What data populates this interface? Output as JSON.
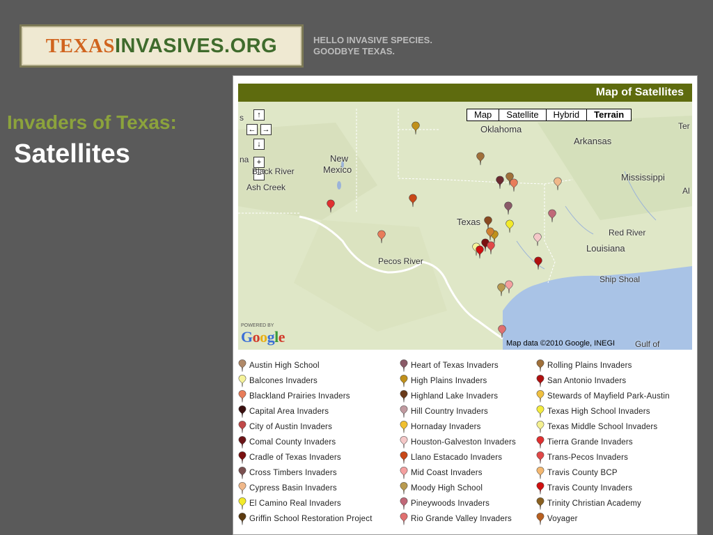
{
  "site": {
    "logo_part1": "TEXAS",
    "logo_part2": "INVASIVES.ORG",
    "tagline_line1": "HELLO INVASIVE SPECIES.",
    "tagline_line2": "GOODBYE TEXAS."
  },
  "page": {
    "heading_line1": "Invaders of Texas:",
    "heading_line2": "Satellites"
  },
  "panel": {
    "title": "Map of Satellites",
    "map_types": [
      "Map",
      "Satellite",
      "Hybrid",
      "Terrain"
    ],
    "selected_map_type": "Terrain",
    "attribution": "Map data ©2010 Google, INEGI",
    "powered_by": "POWERED BY",
    "google_logo": "Google",
    "nav_buttons": {
      "up": "↑",
      "left": "←",
      "right": "→",
      "down": "↓",
      "zoom_in": "+",
      "zoom_out": "−"
    },
    "map_labels": [
      {
        "name": "label-oklahoma",
        "text": "Oklahoma"
      },
      {
        "name": "label-arkansas",
        "text": "Arkansas"
      },
      {
        "name": "label-mississippi",
        "text": "Mississippi"
      },
      {
        "name": "label-new",
        "text": "New"
      },
      {
        "name": "label-mexico",
        "text": "Mexico"
      },
      {
        "name": "label-black-river",
        "text": "Black River"
      },
      {
        "name": "label-ash-creek",
        "text": "Ash Creek"
      },
      {
        "name": "label-texas",
        "text": "Texas"
      },
      {
        "name": "label-red-river",
        "text": "Red River"
      },
      {
        "name": "label-louisiana",
        "text": "Louisiana"
      },
      {
        "name": "label-pecos-river",
        "text": "Pecos River"
      },
      {
        "name": "label-ship-shoal",
        "text": "Ship Shoal"
      },
      {
        "name": "label-gulf-of",
        "text": "Gulf of"
      },
      {
        "name": "label-ter",
        "text": "Ter"
      },
      {
        "name": "label-al",
        "text": "Al"
      },
      {
        "name": "label-edge-s",
        "text": "s"
      },
      {
        "name": "label-edge-na",
        "text": "na"
      }
    ]
  },
  "legend": {
    "columns": [
      [
        {
          "label": "Austin High School",
          "color": "#b08968"
        },
        {
          "label": "Balcones Invaders",
          "color": "#f5f29a"
        },
        {
          "label": "Blackland Prairies Invaders",
          "color": "#e87c5a"
        },
        {
          "label": "Capital Area Invaders",
          "color": "#3a1010"
        },
        {
          "label": "City of Austin Invaders",
          "color": "#c04848"
        },
        {
          "label": "Comal County Invaders",
          "color": "#6b1518"
        },
        {
          "label": "Cradle of Texas Invaders",
          "color": "#7a1010"
        },
        {
          "label": "Cross Timbers Invaders",
          "color": "#7a5050"
        },
        {
          "label": "Cypress Basin Invaders",
          "color": "#f0b88a"
        },
        {
          "label": "El Camino Real Invaders",
          "color": "#f2ea2a"
        },
        {
          "label": "Griffin School Restoration Project",
          "color": "#5c3a10"
        }
      ],
      [
        {
          "label": "Heart of Texas Invaders",
          "color": "#8a5a68"
        },
        {
          "label": "High Plains Invaders",
          "color": "#c0901a"
        },
        {
          "label": "Highland Lake Invaders",
          "color": "#6a3a1a"
        },
        {
          "label": "Hill Country Invaders",
          "color": "#c09aa0"
        },
        {
          "label": "Hornaday Invaders",
          "color": "#f0c030"
        },
        {
          "label": "Houston-Galveston Invaders",
          "color": "#f4c8c8"
        },
        {
          "label": "Llano Estacado Invaders",
          "color": "#c84818"
        },
        {
          "label": "Mid Coast Invaders",
          "color": "#f4a0a0"
        },
        {
          "label": "Moody High School",
          "color": "#b89a50"
        },
        {
          "label": "Pineywoods Invaders",
          "color": "#c06878"
        },
        {
          "label": "Rio Grande Valley Invaders",
          "color": "#e07070"
        }
      ],
      [
        {
          "label": "Rolling Plains Invaders",
          "color": "#a0703a"
        },
        {
          "label": "San Antonio Invaders",
          "color": "#b01010"
        },
        {
          "label": "Stewards of Mayfield Park-Austin",
          "color": "#f0c040"
        },
        {
          "label": "Texas High School Invaders",
          "color": "#f4ec40"
        },
        {
          "label": "Texas Middle School Invaders",
          "color": "#f4f090"
        },
        {
          "label": "Tierra Grande Invaders",
          "color": "#e03030"
        },
        {
          "label": "Trans-Pecos Invaders",
          "color": "#e04848"
        },
        {
          "label": "Travis County BCP",
          "color": "#f4b870"
        },
        {
          "label": "Travis County Invaders",
          "color": "#d01010"
        },
        {
          "label": "Trinity Christian Academy",
          "color": "#8a6020"
        },
        {
          "label": "Voyager",
          "color": "#b86020"
        }
      ]
    ]
  },
  "markers": [
    {
      "color": "#c0901a"
    },
    {
      "color": "#a0703a"
    },
    {
      "color": "#a0703a"
    },
    {
      "color": "#6b2a30"
    },
    {
      "color": "#e87c5a"
    },
    {
      "color": "#f0b88a"
    },
    {
      "color": "#c84818"
    },
    {
      "color": "#e03030"
    },
    {
      "color": "#8a5a68"
    },
    {
      "color": "#c06878"
    },
    {
      "color": "#e87c5a"
    },
    {
      "color": "#8a4a20"
    },
    {
      "color": "#f2ea2a"
    },
    {
      "color": "#f4c8c8"
    },
    {
      "color": "#c0901a"
    },
    {
      "color": "#d08030"
    },
    {
      "color": "#7a1010"
    },
    {
      "color": "#f5f29a"
    },
    {
      "color": "#d01010"
    },
    {
      "color": "#e04848"
    },
    {
      "color": "#b01010"
    },
    {
      "color": "#f4a0a0"
    },
    {
      "color": "#b89a50"
    },
    {
      "color": "#e07070"
    }
  ]
}
